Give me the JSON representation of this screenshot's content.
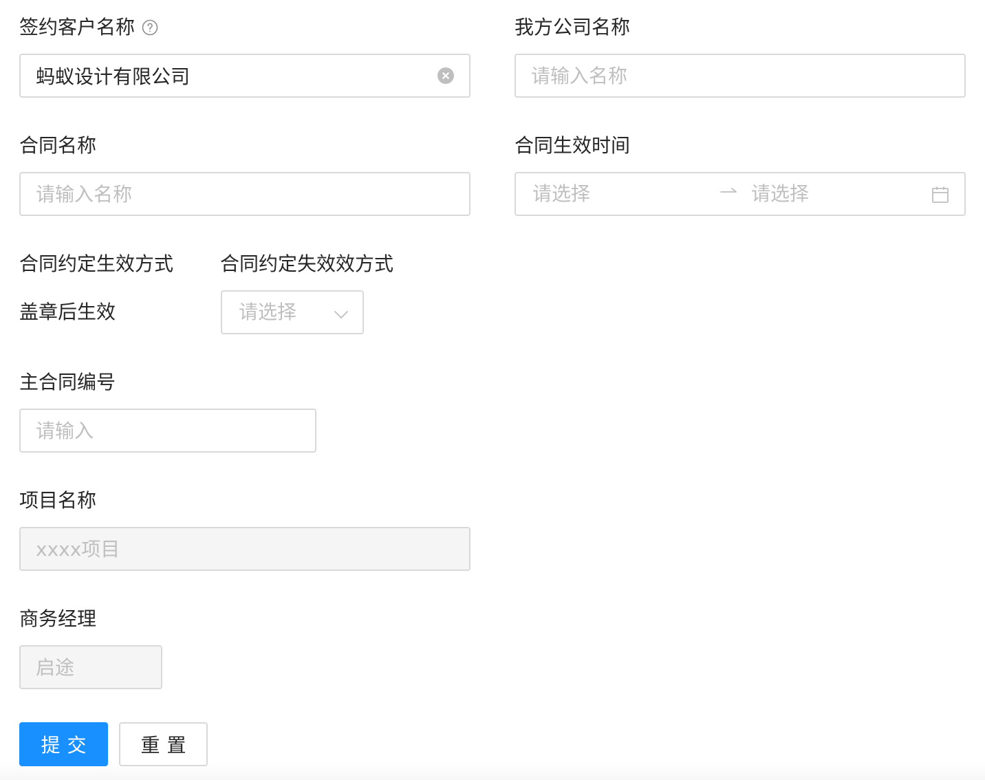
{
  "form": {
    "customer_name": {
      "label": "签约客户名称",
      "value": "蚂蚁设计有限公司"
    },
    "our_company": {
      "label": "我方公司名称",
      "placeholder": "请输入名称"
    },
    "contract_name": {
      "label": "合同名称",
      "placeholder": "请输入名称"
    },
    "effective_time": {
      "label": "合同生效时间",
      "start_placeholder": "请选择",
      "end_placeholder": "请选择",
      "separator": "→"
    },
    "effective_method": {
      "label": "合同约定生效方式",
      "value": "盖章后生效"
    },
    "expiry_method": {
      "label": "合同约定失效效方式",
      "placeholder": "请选择"
    },
    "main_contract_no": {
      "label": "主合同编号",
      "placeholder": "请输入"
    },
    "project_name": {
      "label": "项目名称",
      "placeholder": "xxxx项目"
    },
    "business_manager": {
      "label": "商务经理",
      "placeholder": "启途"
    }
  },
  "actions": {
    "submit_label": "提交",
    "reset_label": "重置"
  },
  "icons": {
    "help": "question-circle-icon",
    "clear": "close-circle-icon",
    "calendar": "calendar-icon",
    "dropdown": "chevron-down-icon"
  },
  "colors": {
    "primary": "#1890ff",
    "border": "#d9d9d9",
    "placeholder": "#bfbfbf",
    "disabled_bg": "#f5f5f5"
  }
}
